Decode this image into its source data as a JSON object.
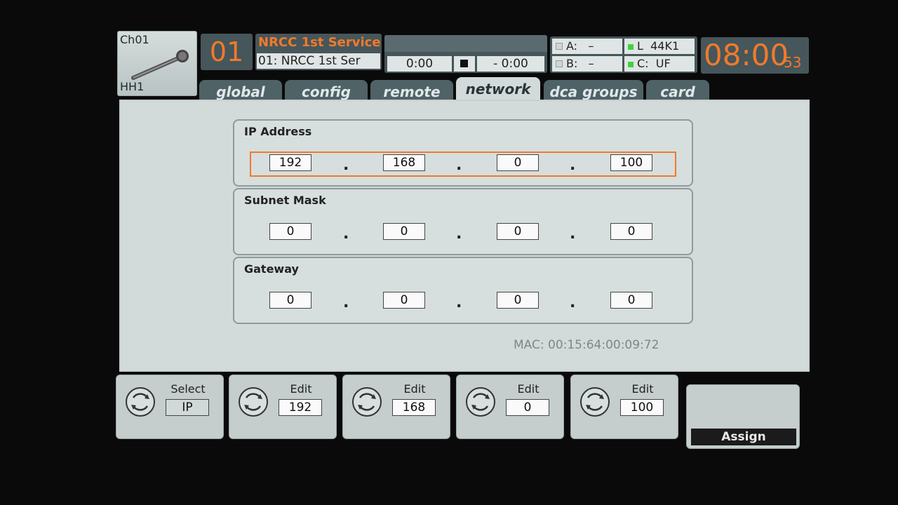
{
  "channel": {
    "number": "Ch01",
    "name": "HH1",
    "icon": "microphone-icon"
  },
  "scene": {
    "number": "01",
    "title": "NRCC 1st Service",
    "subtitle": "01: NRCC 1st Ser"
  },
  "transport": {
    "elapsed": "0:00",
    "remaining": "- 0:00",
    "stop_icon": "stop-icon"
  },
  "status": {
    "a_label": "A:",
    "a_value": "–",
    "b_label": "B:",
    "b_value": "–",
    "l_label": "L",
    "l_value": "44K1",
    "c_label": "C:",
    "c_value": "UF",
    "indicator_color": "#3fd23f"
  },
  "clock": {
    "hhmm": "08:00",
    "seconds": "53"
  },
  "tabs": [
    {
      "label": "global",
      "active": false
    },
    {
      "label": "config",
      "active": false
    },
    {
      "label": "remote",
      "active": false
    },
    {
      "label": "network",
      "active": true
    },
    {
      "label": "dca groups",
      "active": false
    },
    {
      "label": "card",
      "active": false
    }
  ],
  "network": {
    "ip": {
      "title": "IP Address",
      "octets": [
        "192",
        "168",
        "0",
        "100"
      ]
    },
    "subnet": {
      "title": "Subnet Mask",
      "octets": [
        "0",
        "0",
        "0",
        "0"
      ]
    },
    "gateway": {
      "title": "Gateway",
      "octets": [
        "0",
        "0",
        "0",
        "0"
      ]
    },
    "separator": ".",
    "mac": "MAC: 00:15:64:00:09:72"
  },
  "encoders": [
    {
      "label": "Select",
      "value": "IP"
    },
    {
      "label": "Edit",
      "value": "192"
    },
    {
      "label": "Edit",
      "value": "168"
    },
    {
      "label": "Edit",
      "value": "0"
    },
    {
      "label": "Edit",
      "value": "100"
    }
  ],
  "assign_label": "Assign",
  "accent_color": "#f07a2a"
}
